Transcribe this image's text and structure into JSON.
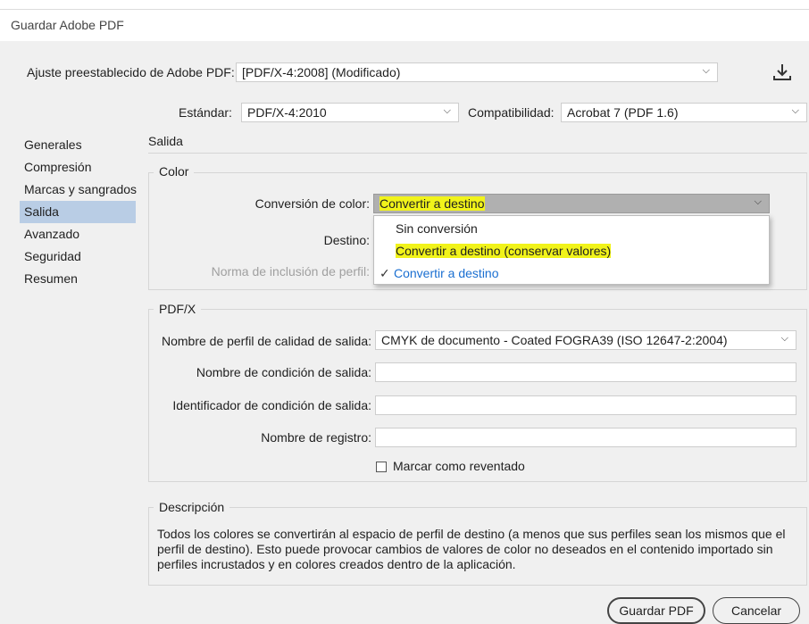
{
  "window": {
    "title": "Guardar Adobe PDF"
  },
  "preset": {
    "label": "Ajuste preestablecido de Adobe PDF:",
    "value": "[PDF/X-4:2008] (Modificado)"
  },
  "standard": {
    "label": "Estándar:",
    "value": "PDF/X-4:2010"
  },
  "compat": {
    "label": "Compatibilidad:",
    "value": "Acrobat 7 (PDF 1.6)"
  },
  "sidebar": {
    "items": [
      {
        "label": "Generales"
      },
      {
        "label": "Compresión"
      },
      {
        "label": "Marcas y sangrados"
      },
      {
        "label": "Salida"
      },
      {
        "label": "Avanzado"
      },
      {
        "label": "Seguridad"
      },
      {
        "label": "Resumen"
      }
    ]
  },
  "section": {
    "title": "Salida"
  },
  "color": {
    "group_title": "Color",
    "conversion_label": "Conversión de color:",
    "conversion_value": "Convertir a destino",
    "destino_label": "Destino:",
    "profile_policy_label": "Norma de inclusión de perfil:",
    "options": [
      {
        "label": "Sin conversión"
      },
      {
        "label": "Convertir a destino (conservar valores)"
      },
      {
        "label": "Convertir a destino",
        "check": "✓"
      }
    ]
  },
  "pdfx": {
    "group_title": "PDF/X",
    "output_profile_label": "Nombre de perfil de calidad de salida:",
    "output_profile_value": "CMYK de documento - Coated FOGRA39 (ISO 12647-2:2004)",
    "condition_name_label": "Nombre de condición de salida:",
    "condition_id_label": "Identificador de condición de salida:",
    "registry_label": "Nombre de registro:",
    "trapped_label": "Marcar como reventado"
  },
  "description": {
    "group_title": "Descripción",
    "text": "Todos los colores se convertirán al espacio de perfil de destino (a menos que sus perfiles sean los mismos que el perfil de destino). Esto puede provocar cambios de valores de color no deseados en el contenido importado sin perfiles incrustados y en colores creados dentro de la aplicación."
  },
  "buttons": {
    "save": "Guardar PDF",
    "cancel": "Cancelar"
  },
  "icons": {
    "chevron": "⌄",
    "download": "⤓"
  },
  "colors": {
    "highlight": "#f1f31a",
    "selected_option": "#1a6fd1",
    "sidebar_active": "#b9cde5"
  }
}
